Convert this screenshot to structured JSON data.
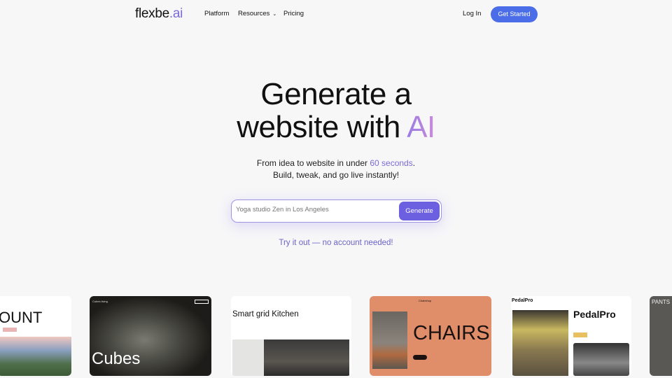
{
  "nav": {
    "logo_main": "flexbe",
    "logo_suffix": ".ai",
    "items": [
      "Platform",
      "Resources",
      "Pricing"
    ],
    "login": "Log In",
    "cta": "Get Started"
  },
  "hero": {
    "line1": "Generate a",
    "line2_main": "website with ",
    "line2_accent": "AI",
    "sub1_pre": "From idea to website in under ",
    "sub1_highlight": "60 seconds",
    "sub1_post": ".",
    "sub2": "Build, tweak, and go live instantly!"
  },
  "search": {
    "placeholder": "Yoga studio Zen in Los Angeles",
    "button": "Generate"
  },
  "try_link": "Try it out — no account needed!",
  "colors": {
    "accent": "#6c5fe0",
    "cta": "#4b6ee8"
  },
  "cards": [
    {
      "title": "OUNT"
    },
    {
      "brand": "Cubes living",
      "title": "Cubes"
    },
    {
      "title": "Smart grid Kitchen"
    },
    {
      "brand": "Chairshop",
      "title": "CHAIRS"
    },
    {
      "brand": "PedalPro",
      "title": "PedalPro"
    },
    {
      "title": "PANTS"
    }
  ]
}
